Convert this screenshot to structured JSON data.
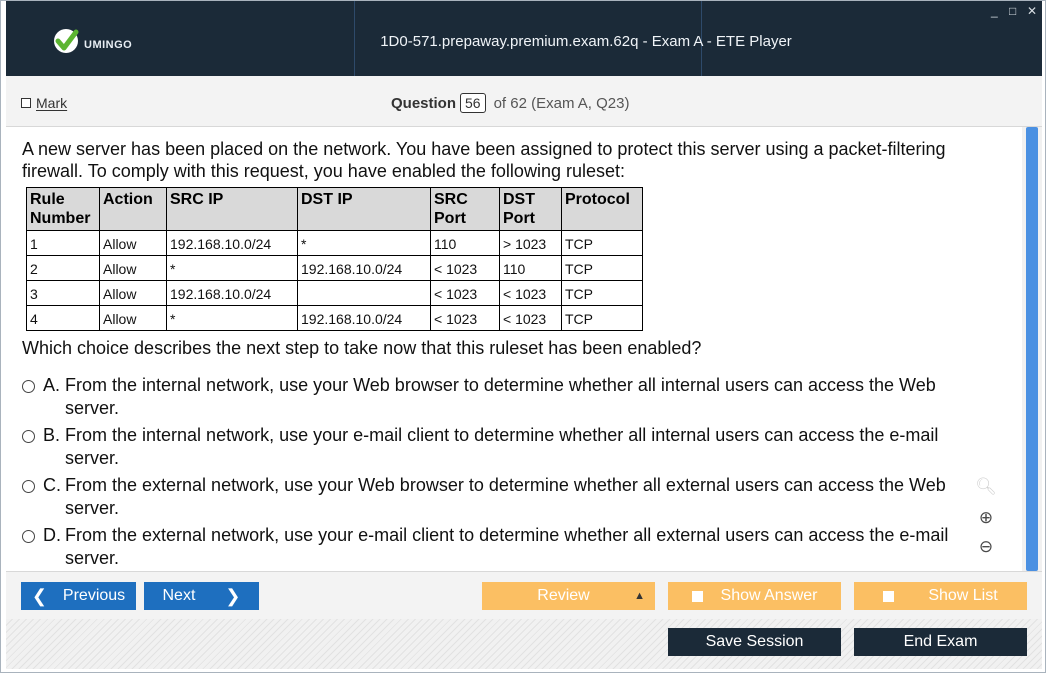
{
  "header": {
    "logo_text": "UMINGO",
    "title": "1D0-571.prepaway.premium.exam.62q - Exam A - ETE Player",
    "minimize": "_",
    "maximize": "□",
    "close": "✕"
  },
  "question_bar": {
    "mark_label": "Mark",
    "question_label": "Question",
    "question_number": "56",
    "of_text": "of 62 (Exam A, Q23)"
  },
  "question": {
    "text": "A new server has been placed on the network. You have been assigned to protect this server using a packet-filtering firewall. To comply with this request, you have enabled the following ruleset:",
    "table": {
      "headers": [
        "Rule Number",
        "Action",
        "SRC IP",
        "DST IP",
        "SRC Port",
        "DST Port",
        "Protocol"
      ],
      "rows": [
        [
          "1",
          "Allow",
          "192.168.10.0/24",
          "*",
          "110",
          "> 1023",
          "TCP"
        ],
        [
          "2",
          "Allow",
          "*",
          "192.168.10.0/24",
          "< 1023",
          "110",
          "TCP"
        ],
        [
          "3",
          "Allow",
          "192.168.10.0/24",
          "",
          "< 1023",
          "< 1023",
          "TCP"
        ],
        [
          "4",
          "Allow",
          "*",
          "192.168.10.0/24",
          "< 1023",
          "< 1023",
          "TCP"
        ]
      ]
    },
    "ask": "Which choice describes the next step to take now that this ruleset has been enabled?",
    "options": [
      {
        "letter": "A.",
        "text": "From the internal network, use your Web browser to determine whether all internal users can access the Web server."
      },
      {
        "letter": "B.",
        "text": "From the internal network, use your e-mail client to determine whether all internal users can access the e-mail server."
      },
      {
        "letter": "C.",
        "text": "From the external network, use your Web browser to determine whether all external users can access the Web server."
      },
      {
        "letter": "D.",
        "text": "From the external network, use your e-mail client to determine whether all external users can access the e-mail server."
      }
    ]
  },
  "nav": {
    "previous": "Previous",
    "next": "Next",
    "review": "Review",
    "show_answer": "Show Answer",
    "show_list": "Show List",
    "save_session": "Save Session",
    "end_exam": "End Exam"
  },
  "colors": {
    "header_bg": "#1b2a38",
    "nav_blue": "#1e6fbf",
    "nav_orange": "#fbbf63",
    "scrollbar": "#4a90e2"
  }
}
